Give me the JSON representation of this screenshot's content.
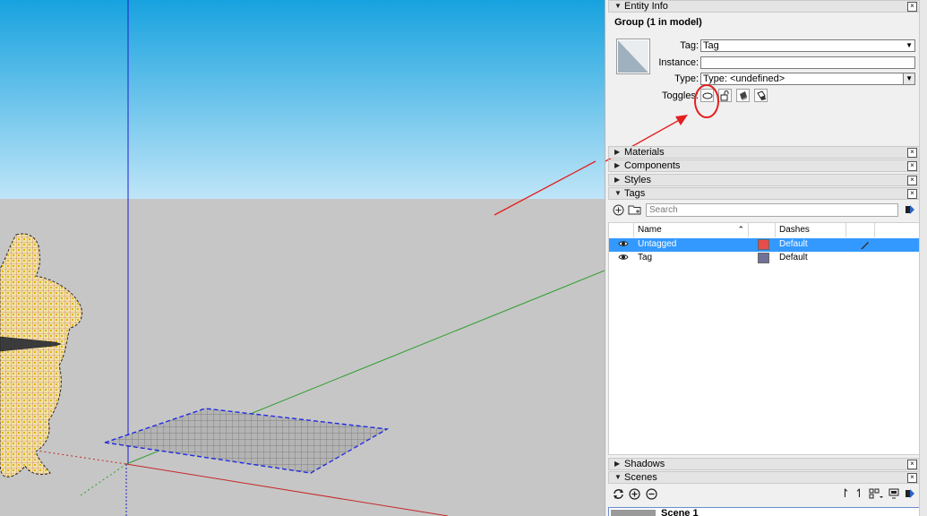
{
  "entity_info": {
    "tray_title": "Entity Info",
    "heading": "Group (1 in model)",
    "tag_label": "Tag:",
    "tag_value": "Tag",
    "instance_label": "Instance:",
    "instance_value": "",
    "type_label": "Type:",
    "type_value": "Type: <undefined>",
    "toggles_label": "Toggles:",
    "toggles": [
      "hidden-toggle-icon",
      "lock-toggle-icon",
      "receive-shadows-icon",
      "cast-shadows-icon"
    ]
  },
  "trays": {
    "materials": "Materials",
    "components": "Components",
    "styles": "Styles",
    "tags": "Tags",
    "shadows": "Shadows",
    "scenes": "Scenes"
  },
  "close_glyph": "×",
  "tags": {
    "search_placeholder": "Search",
    "columns": {
      "name": "Name",
      "dashes": "Dashes"
    },
    "rows": [
      {
        "name": "Untagged",
        "dashes": "Default",
        "color": "#e84c4c",
        "selected": true
      },
      {
        "name": "Tag",
        "dashes": "Default",
        "color": "#6f7296",
        "selected": false
      }
    ]
  },
  "scenes": {
    "first_scene_label": "Scene 1"
  },
  "colors": {
    "sky_top": "#1ea6e0",
    "sky_bottom": "#bfe4f7",
    "ground": "#c7c7c7",
    "selection_blue": "#3399ff",
    "annotation_red": "#e32020"
  }
}
